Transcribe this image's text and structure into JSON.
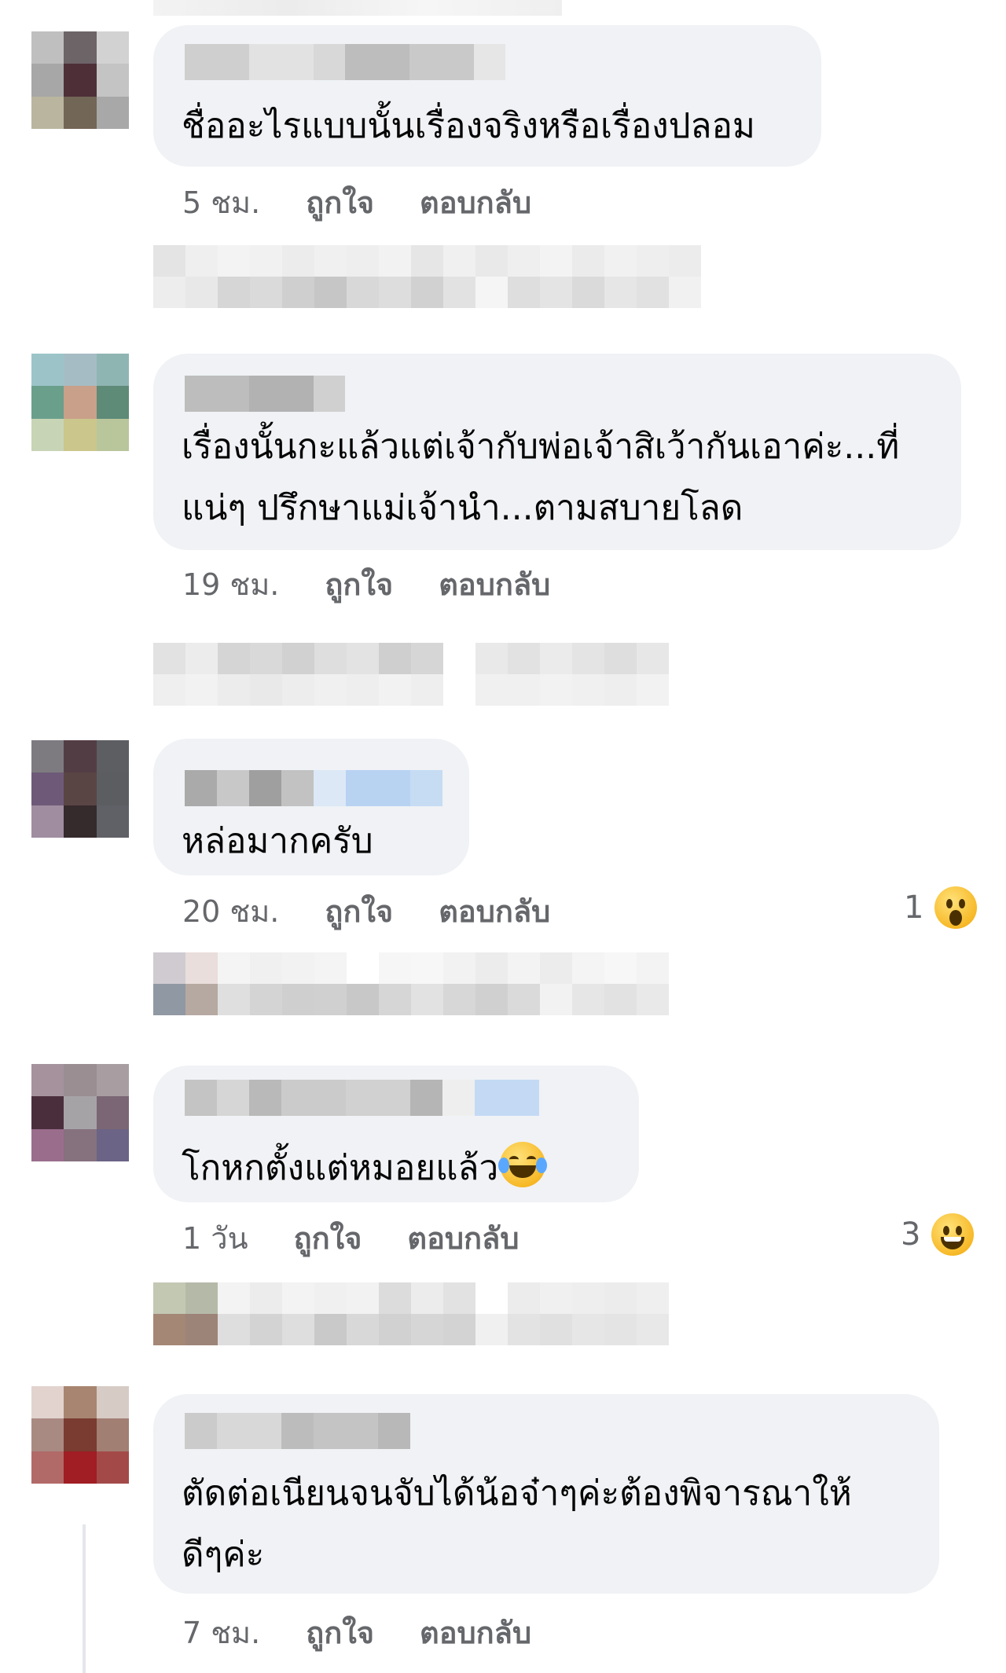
{
  "comments": [
    {
      "text": "ชื่ออะไรแบบนั้นเรื่องจริงหรือเรื่องปลอม",
      "time": "5 ชม.",
      "like_label": "ถูกใจ",
      "reply_label": "ตอบกลับ",
      "reaction_count": null
    },
    {
      "text": "เรื่องนั้นกะแล้วแต่เจ้ากับพ่อเจ้าสิเว้ากันเอาค่ะ...ที่\nแน่ๆ ปรึกษาแม่เจ้านำ...ตามสบายโลด",
      "time": "19 ชม.",
      "like_label": "ถูกใจ",
      "reply_label": "ตอบกลับ",
      "reaction_count": null
    },
    {
      "text": "หล่อมากครับ",
      "time": "20 ชม.",
      "like_label": "ถูกใจ",
      "reply_label": "ตอบกลับ",
      "reaction_count": "1",
      "reaction_icon": "wow-reaction-icon"
    },
    {
      "text": "โกหกตั้งแต่หมอยแล้ว",
      "inline_emoji": "laughing-tears-emoji",
      "time": "1 วัน",
      "like_label": "ถูกใจ",
      "reply_label": "ตอบกลับ",
      "reaction_count": "3",
      "reaction_icon": "haha-reaction-icon"
    },
    {
      "text": "ตัดต่อเนียนจนจับได้น้อจ๋าๆค่ะต้องพิจารณาให้\nดีๆค่ะ",
      "time": "7 ชม.",
      "like_label": "ถูกใจ",
      "reply_label": "ตอบกลับ",
      "reaction_count": null
    }
  ],
  "colors": {
    "bubble": "#f0f2f5",
    "meta_text": "#65676b",
    "body_text": "#050505",
    "reaction_yellow": "#f7b928"
  }
}
